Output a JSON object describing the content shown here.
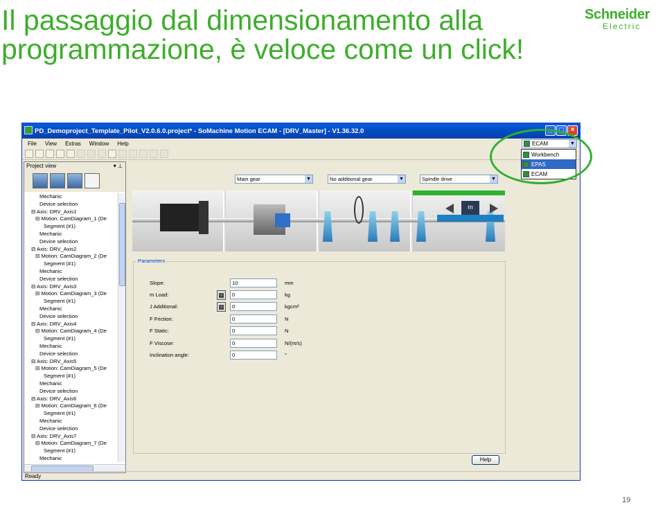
{
  "slide": {
    "title_line1": "Il passaggio dal dimensionamento alla",
    "title_line2": "programmazione, è veloce come un click!",
    "logo_line1": "Schneider",
    "logo_line2": "Electric",
    "page_number": "19"
  },
  "window": {
    "title": "PD_Demoproject_Template_Pilot_V2.0.6.0.project* - SoMachine Motion ECAM - [DRV_Master] - V1.36.32.0",
    "menu": [
      "File",
      "View",
      "Extras",
      "Window",
      "Help"
    ],
    "status": "Ready"
  },
  "perspective": {
    "selected": "ECAM",
    "options": [
      "Workbench",
      "EPAS",
      "ECAM"
    ],
    "highlighted": "EPAS"
  },
  "project_view": {
    "title": "Project view",
    "tree": [
      {
        "text": "Mechanic",
        "indent": 3
      },
      {
        "text": "Device selection",
        "indent": 3
      },
      {
        "text": "⊟ Axis: DRV_Axis1",
        "indent": 1
      },
      {
        "text": "⊟ Motion: CamDiagram_1 (De",
        "indent": 2
      },
      {
        "text": "Segment (#1)",
        "indent": 4
      },
      {
        "text": "Mechanic",
        "indent": 3
      },
      {
        "text": "Device selection",
        "indent": 3
      },
      {
        "text": "⊟ Axis: DRV_Axis2",
        "indent": 1
      },
      {
        "text": "⊟ Motion: CamDiagram_2 (De",
        "indent": 2
      },
      {
        "text": "Segment (#1)",
        "indent": 4
      },
      {
        "text": "Mechanic",
        "indent": 3
      },
      {
        "text": "Device selection",
        "indent": 3
      },
      {
        "text": "⊟ Axis: DRV_Axis3",
        "indent": 1
      },
      {
        "text": "⊟ Motion: CamDiagram_3 (De",
        "indent": 2
      },
      {
        "text": "Segment (#1)",
        "indent": 4
      },
      {
        "text": "Mechanic",
        "indent": 3
      },
      {
        "text": "Device selection",
        "indent": 3
      },
      {
        "text": "⊟ Axis: DRV_Axis4",
        "indent": 1
      },
      {
        "text": "⊟ Motion: CamDiagram_4 (De",
        "indent": 2
      },
      {
        "text": "Segment (#1)",
        "indent": 4
      },
      {
        "text": "Mechanic",
        "indent": 3
      },
      {
        "text": "Device selection",
        "indent": 3
      },
      {
        "text": "⊟ Axis: DRV_Axis5",
        "indent": 1
      },
      {
        "text": "⊟ Motion: CamDiagram_5 (De",
        "indent": 2
      },
      {
        "text": "Segment (#1)",
        "indent": 4
      },
      {
        "text": "Mechanic",
        "indent": 3
      },
      {
        "text": "Device selection",
        "indent": 3
      },
      {
        "text": "⊟ Axis: DRV_Axis6",
        "indent": 1
      },
      {
        "text": "⊟ Motion: CamDiagram_6 (De",
        "indent": 2
      },
      {
        "text": "Segment (#1)",
        "indent": 4
      },
      {
        "text": "Mechanic",
        "indent": 3
      },
      {
        "text": "Device selection",
        "indent": 3
      },
      {
        "text": "⊟ Axis: DRV_Axis7",
        "indent": 1
      },
      {
        "text": "⊟ Motion: CamDiagram_7 (De",
        "indent": 2
      },
      {
        "text": "Segment (#1)",
        "indent": 4
      },
      {
        "text": "Mechanic",
        "indent": 3
      }
    ]
  },
  "drive_config": {
    "gear": "Main gear",
    "additional_gear": "No additional gear",
    "drive_type": "Spindle drive",
    "mass_label": "m"
  },
  "parameters": {
    "legend": "Parameters",
    "rows": [
      {
        "label": "Slope:",
        "value": "10",
        "unit": "mm",
        "calc": false
      },
      {
        "label": "m Load:",
        "value": "0",
        "unit": "kg",
        "calc": true
      },
      {
        "label": "J Additional:",
        "value": "0",
        "unit": "kgcm²",
        "calc": true
      },
      {
        "label": "F Friction:",
        "value": "0",
        "unit": "N",
        "calc": false
      },
      {
        "label": "F Static:",
        "value": "0",
        "unit": "N",
        "calc": false
      },
      {
        "label": "F Viscose:",
        "value": "0",
        "unit": "N/(m/s)",
        "calc": false
      },
      {
        "label": "Inclination angle:",
        "value": "0",
        "unit": "°",
        "calc": false
      }
    ],
    "help_label": "Help"
  },
  "colors": {
    "brand_green": "#3dae2b",
    "selection_blue": "#316ac5",
    "highlight_ring": "#2fb02f"
  }
}
